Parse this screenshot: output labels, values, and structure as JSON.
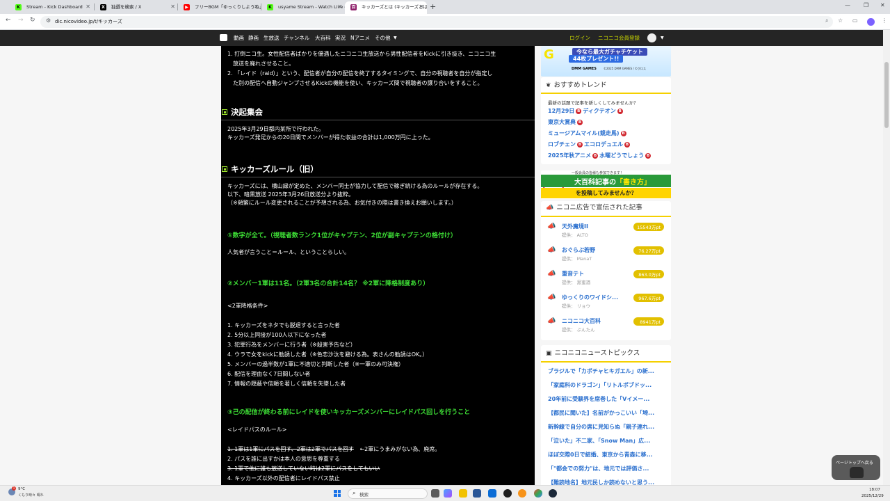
{
  "browser": {
    "tabs": [
      {
        "title": "Stream - Kick Dashboard",
        "favicon": "kick-icon"
      },
      {
        "title": "独選を検索 / X",
        "favicon": "x-icon"
      },
      {
        "title": "フリーBGM「ゆっくりしようね」",
        "favicon": "youtube-icon"
      },
      {
        "title": "usyame Stream - Watch Live o",
        "favicon": "kick-icon"
      },
      {
        "title": "キッカーズとは (キッカーズとは) [単",
        "favicon": "nicopedia-icon",
        "active": true
      }
    ],
    "url": "dic.nicovideo.jp/t/キッカーズ"
  },
  "niconav": {
    "items": [
      "動画",
      "静画",
      "生放送",
      "チャンネル",
      "大百科",
      "実況",
      "Nアニメ",
      "その他"
    ],
    "login": "ログイン",
    "register": "ニコニコ会員登録"
  },
  "article": {
    "intro_list": [
      "1. 打倒ニコ生。女性配信者ばかりを優遇したニコニコ生放送から男性配信者をKickに引き抜き、ニコニコ生",
      "　放送を廃れさせること。",
      "2. 「レイド（raid）」という、配信者が自分の配信を終了するタイミングで、自分の視聴者を自分が指定し",
      "　た別の配信へ自動ジャンプさせるKickの機能を使い、キッカーズ間で視聴者の譲り合いをすること。"
    ],
    "section1_heading": "決起集会",
    "section1_body": [
      "2025年3月29日都内某所で行われた。",
      "キッカーズ発足からの20日間でメンバーが得た収益の合計は1,000万円に上った。"
    ],
    "section2_heading": "キッカーズルール（旧）",
    "section2_body": [
      "キッカーズには、横山緑が定めた、メンバー同士が協力して配信で稼ぎ続ける為のルールが存在する。",
      "以下、暗黒放送 2025年3月26日放送分より抜粋。",
      "（※頻繁にルール変更されることが予想される為、お気付きの際は書き換えお願いします。）"
    ],
    "rule1": "①数字が全て。（視聴者数ランク1位がキャプテン、2位が副キャプテンの格付け）",
    "rule1_body": "人気者が言うこと＝ルール、ということらしい。",
    "rule2": "②メンバー1軍は11名。（2軍3名の合計14名？ ※2軍に降格制度あり）",
    "rule2_sub": "<2軍降格条件>",
    "rule2_list": [
      "1. キッカーズをネタでも脱退すると言った者",
      "2. 5分以上同接が100人以下になった者",
      "3. 犯罪行為をメンバーに行う者（※殺害予告など）",
      "4. ウラで女をkickに勧誘した者（※色恋沙汰を避ける為。表さんの勧誘はOK。）",
      "5. メンバーの過半数が1軍に不適切と判断した者（※一軍のみ可決権）",
      "6. 配信を理由なく7日間しない者",
      "7. 情報の隠蔽や信頼を著しく信頼を失墜した者"
    ],
    "rule3": "③己の配信が終わる前にレイドを使いキッカーズメンバーにレイドパス回しを行うこと",
    "rule3_sub": "<レイドパスのルール>",
    "rule3_list_1_struck": "1. 1軍は1軍にパスを回す、2軍は2軍でパスを回す",
    "rule3_list_1_note": "←2軍にうまみがない為、廃席。",
    "rule3_list_2": "2. パスを誰に出すかは本人の意思を尊重する",
    "rule3_list_3_struck": "3. 1軍で他に誰も放送していない時は2軍にパスをしてもいい",
    "rule3_list_4": "4. キッカーズ以外の配信者にレイドパス禁止"
  },
  "sidebar": {
    "banner1": {
      "line1": "今なら最大ガチャチケット",
      "line2": "44枚プレゼント!!",
      "brand": "DMM GAMES",
      "copy": "©2025 DMM GAMES / ©グロス",
      "logo": "G"
    },
    "trend": {
      "title": "おすすめトレンド",
      "intro": "最新の話題で記事を新しくしてみませんか？",
      "rows": [
        [
          "12月29日",
          "ディクテオン"
        ],
        [
          "東京大賞典"
        ],
        [
          "ミュージアムマイル(競走馬)"
        ],
        [
          "ロブチェン",
          "エコロデュエル"
        ],
        [
          "2025年秋アニメ",
          "水曜どうでしょう"
        ]
      ],
      "badge": "B"
    },
    "banner2": {
      "top": "一般会員の皆様も参加できます！",
      "mid1": "大百科記事の",
      "mid2": "「書き方」",
      "bottom": "を投稿してみませんか？"
    },
    "ads": {
      "title": "ニコニ広告で宣伝された記事",
      "items": [
        {
          "title": "天外魔境II",
          "by": "提供： ALTO",
          "pt": "15543万pt"
        },
        {
          "title": "おぐらぶ若野",
          "by": "提供： ManaT",
          "pt": "76.27万pt"
        },
        {
          "title": "重音テト",
          "by": "提供： 黒蜜酒",
          "pt": "863.0万pt"
        },
        {
          "title": "ゆっくりのワイドシ...",
          "by": "提供： リョウ",
          "pt": "967.6万pt"
        },
        {
          "title": "ニコニコ大百科",
          "by": "提供： ぷんたん",
          "pt": "8941万pt"
        }
      ]
    },
    "news": {
      "title": "ニコニコニューストピックス",
      "items": [
        "ブラジルで「カボチャヒキガエル」の新...",
        "「家庭科のドラゴン」「リトルボブドッ...",
        "20年前に受験界を席巻した「Vイメー...",
        "【都民に聞いた】名前がかっこいい「埼...",
        "新幹線で自分の席に見知らぬ「親子連れ...",
        "「泣いた」不二家、「Snow Man」広...",
        "ほぼ交際0日で結婚、東京から青森に移...",
        "「\"都会での努力\"は、地元では評価さ...",
        "【難読地名】地元民しか読めないと思う..."
      ]
    },
    "pagetop": "ページトップへ戻る"
  },
  "taskbar": {
    "weather_temp": "9°C",
    "weather_desc": "くもり時々 晴れ",
    "weather_badge": "1",
    "search_placeholder": "検索",
    "time": "18:07",
    "date": "2025/12/29"
  },
  "colors": {
    "article_bg": "#000000",
    "article_green": "#3ddc35",
    "link_blue": "#2a6fce",
    "nav_bg": "#252525",
    "accent_yellow": "#f5d000"
  }
}
